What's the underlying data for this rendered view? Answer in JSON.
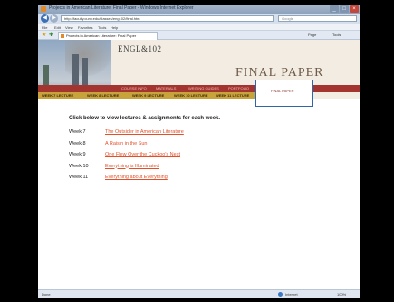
{
  "window": {
    "title": "Projects in American Literature: Final Paper - Windows Internet Explorer",
    "controls": {
      "minimize": "_",
      "maximize": "□",
      "close": "×"
    }
  },
  "address_bar": {
    "url": "http://faculty.cuny.edu/classes/eng102/final.htm",
    "search_placeholder": "Google"
  },
  "menu": [
    "File",
    "Edit",
    "View",
    "Favorites",
    "Tools",
    "Help"
  ],
  "toolbar": {
    "tab_title": "Projects in American Literature: Final Paper",
    "commands": [
      "Page",
      "Tools"
    ]
  },
  "banner": {
    "course": "ENGL&102",
    "heading": "FINAL PAPER",
    "nav_top": [
      "COURSE INFO",
      "MATERIALS",
      "WRITING GUIDES",
      "PORTFOLIO"
    ],
    "nav_bottom": [
      "WEEK 7 LECTURE",
      "WEEK 8 LECTURE",
      "WEEK 9 LECTURE",
      "WEEK 10 LECTURE",
      "WEEK 11 LECTURE"
    ],
    "active_tab": "FINAL PAPER"
  },
  "content": {
    "instructions": "Click below to view lectures & assignments for each week.",
    "weeks": [
      {
        "label": "Week 7",
        "link": "The Outsider in American Literature"
      },
      {
        "label": "Week 8",
        "link": "A Raisin in the Sun"
      },
      {
        "label": "Week 9",
        "link": "One Flew Over the Cuckoo's Nest"
      },
      {
        "label": "Week 10",
        "link": "Everything is Illuminated"
      },
      {
        "label": "Week 11",
        "link": "Everything about Everything"
      }
    ]
  },
  "status_bar": {
    "left": "Done",
    "zone": "Internet",
    "zoom": "100%"
  }
}
